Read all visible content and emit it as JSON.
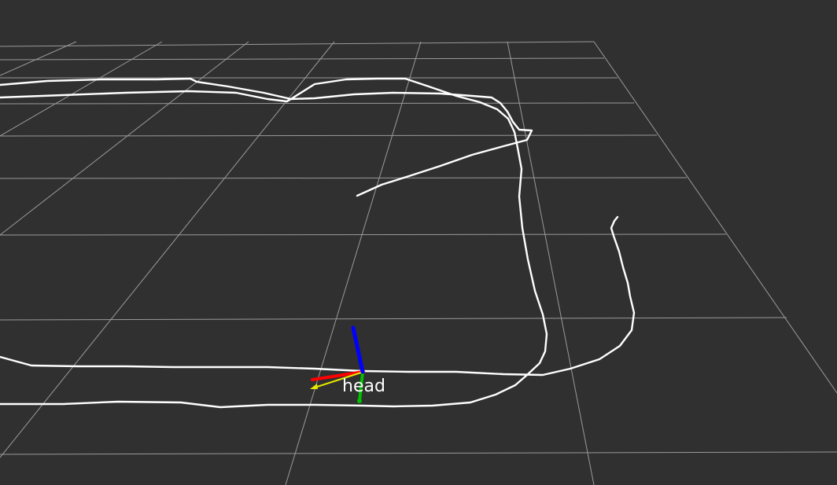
{
  "viewer": {
    "background_color": "#303030",
    "grid_color": "#9a9a9a",
    "trajectory_color": "#ffffff"
  },
  "frame": {
    "label": "head",
    "axes": {
      "x_color": "#ff0000",
      "y_color": "#00c000",
      "z_color": "#0000ff",
      "heading_color": "#e6e600"
    }
  }
}
